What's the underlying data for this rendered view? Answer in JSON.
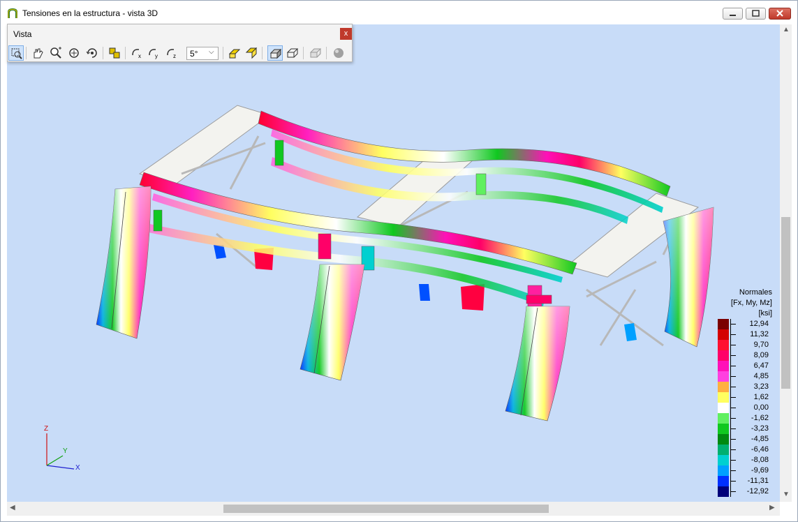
{
  "window": {
    "title": "Tensiones en la estructura - vista 3D",
    "controls": {
      "minimize": "minimize",
      "maximize": "maximize",
      "close": "close"
    }
  },
  "toolbar": {
    "title": "Vista",
    "close_label": "x",
    "angle_value": "5°",
    "buttons": [
      {
        "name": "zoom-window-icon",
        "active": true
      },
      {
        "name": "pan-icon"
      },
      {
        "name": "zoom-icon"
      },
      {
        "name": "rotate-icon"
      },
      {
        "name": "rotate-3d-icon"
      },
      {
        "name": "show-all-icon"
      },
      {
        "name": "rotate-x-icon"
      },
      {
        "name": "rotate-y-icon"
      },
      {
        "name": "rotate-z-icon"
      },
      {
        "name": "view-iso-1-icon"
      },
      {
        "name": "view-iso-2-icon"
      },
      {
        "name": "solid-render-icon",
        "active": true
      },
      {
        "name": "wireframe-render-icon"
      },
      {
        "name": "transparent-render-icon"
      },
      {
        "name": "sphere-render-icon"
      }
    ]
  },
  "legend": {
    "title_line1": "Normales",
    "title_line2": "[Fx, My, Mz]",
    "unit": "[ksi]",
    "items": [
      {
        "label": "12,94",
        "color": "#7a0000"
      },
      {
        "label": "11,32",
        "color": "#d40000"
      },
      {
        "label": "9,70",
        "color": "#ff1030"
      },
      {
        "label": "8,09",
        "color": "#ff0068"
      },
      {
        "label": "6,47",
        "color": "#ff10b8"
      },
      {
        "label": "4,85",
        "color": "#ff40e0"
      },
      {
        "label": "3,23",
        "color": "#ffb040"
      },
      {
        "label": "1,62",
        "color": "#ffff60"
      },
      {
        "label": "0,00",
        "color": "#ffffff"
      },
      {
        "label": "-1,62",
        "color": "#60f060"
      },
      {
        "label": "-3,23",
        "color": "#10c820"
      },
      {
        "label": "-4,85",
        "color": "#008a10"
      },
      {
        "label": "-6,46",
        "color": "#00b070"
      },
      {
        "label": "-8,08",
        "color": "#00d0d0"
      },
      {
        "label": "-9,69",
        "color": "#00a0ff"
      },
      {
        "label": "-11,31",
        "color": "#0030ff"
      },
      {
        "label": "-12,92",
        "color": "#00007a"
      }
    ]
  },
  "axes": {
    "z": "Z",
    "y": "Y",
    "x": "X"
  }
}
